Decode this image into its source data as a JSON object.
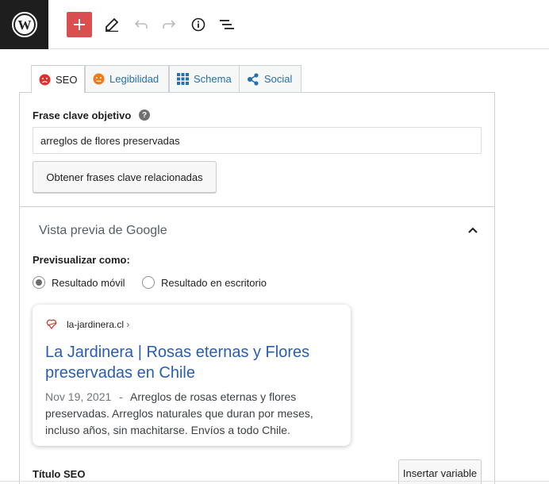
{
  "toolbar": {
    "logo_icon": "wordpress-logo-icon",
    "add_icon": "plus-icon",
    "tools_icon": "pencil-icon",
    "undo_icon": "undo-icon",
    "redo_icon": "redo-icon",
    "details_icon": "info-icon",
    "outline_icon": "list-view-icon"
  },
  "tabs": [
    {
      "label": "SEO",
      "icon": "sad-face-icon",
      "active": true
    },
    {
      "label": "Legibilidad",
      "icon": "neutral-face-icon",
      "active": false
    },
    {
      "label": "Schema",
      "icon": "grid-icon",
      "active": false
    },
    {
      "label": "Social",
      "icon": "share-icon",
      "active": false
    }
  ],
  "focus_keyphrase": {
    "label": "Frase clave objetivo",
    "help_icon": "question-icon",
    "value": "arreglos de flores preservadas",
    "related_button": "Obtener frases clave relacionadas"
  },
  "google_preview": {
    "title": "Vista previa de Google",
    "preview_as_label": "Previsualizar como:",
    "options": [
      {
        "label": "Resultado móvil",
        "selected": true
      },
      {
        "label": "Resultado en escritorio",
        "selected": false
      }
    ],
    "serp": {
      "url": "la-jardinera.cl",
      "url_chevron": "›",
      "title": "La Jardinera | Rosas eternas y Flores preservadas en Chile",
      "date": "Nov 19, 2021",
      "separator": "-",
      "description": "Arreglos de rosas eternas y flores preservadas. Arreglos naturales que duran por meses, incluso años, sin machitarse. Envíos a todo Chile."
    }
  },
  "seo_title": {
    "label": "Título SEO",
    "insert_button": "Insertar variable"
  },
  "colors": {
    "accent_red": "#d94f4f",
    "link_blue": "#2271b1",
    "serp_title": "#2a5db0"
  }
}
